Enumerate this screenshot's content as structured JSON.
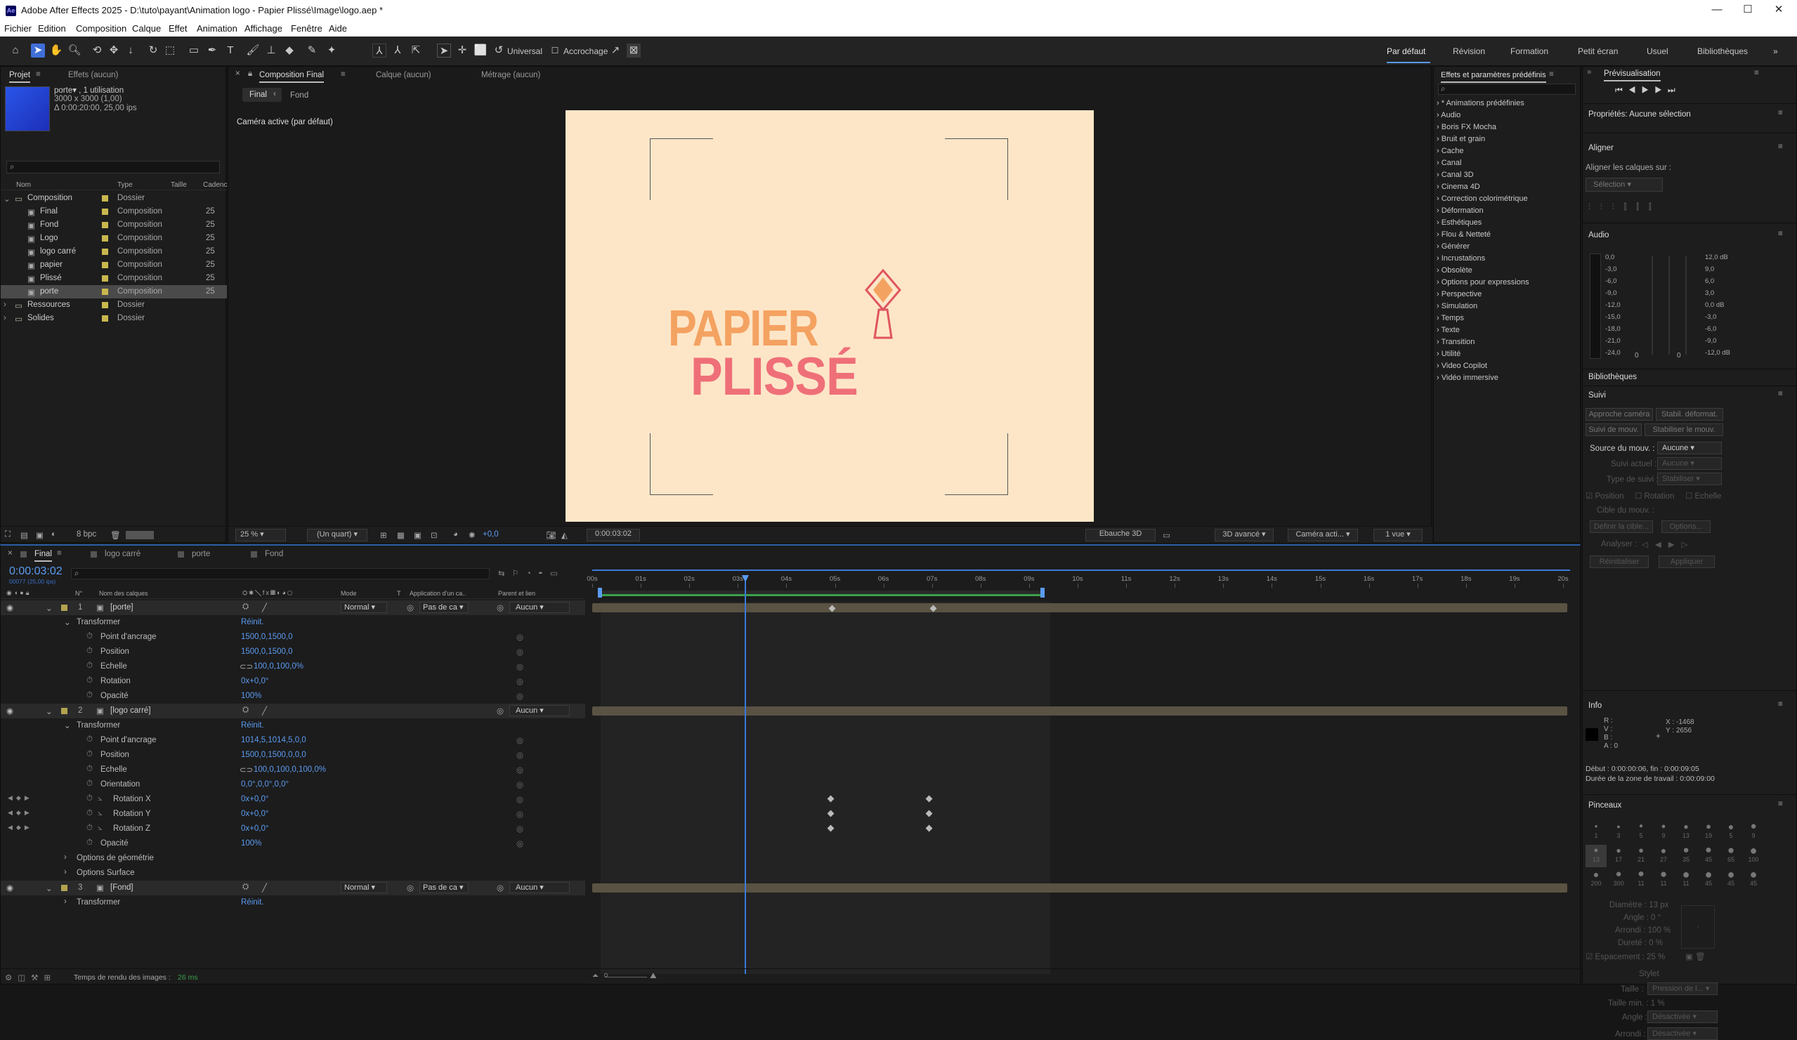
{
  "app": {
    "title": "Adobe After Effects 2025 - D:\\tuto\\payant\\Animation logo - Papier Plissé\\Image\\logo.aep *",
    "logo": "Ae"
  },
  "menu": [
    "Fichier",
    "Edition",
    "Composition",
    "Calque",
    "Effet",
    "Animation",
    "Affichage",
    "Fenêtre",
    "Aide"
  ],
  "toolbar": {
    "universal": "Universal",
    "snapping": "Accrochage"
  },
  "workspaces": [
    "Par défaut",
    "Révision",
    "Formation",
    "Petit écran",
    "Usuel",
    "Bibliothèques"
  ],
  "project": {
    "tabs": [
      "Projet",
      "Effets (aucun)"
    ],
    "selected_name": "porte▾ , 1 utilisation",
    "selected_size": "3000 x 3000 (1,00)",
    "selected_duration": "Δ 0:00:20:00, 25,00 ips",
    "columns": [
      "Nom",
      "Type",
      "Taille",
      "Cadenc"
    ],
    "items": [
      {
        "name": "Composition",
        "type": "Dossier",
        "fps": "",
        "indent": 0,
        "folder": true,
        "open": true
      },
      {
        "name": "Final",
        "type": "Composition",
        "fps": "25",
        "indent": 1
      },
      {
        "name": "Fond",
        "type": "Composition",
        "fps": "25",
        "indent": 1
      },
      {
        "name": "Logo",
        "type": "Composition",
        "fps": "25",
        "indent": 1
      },
      {
        "name": "logo carré",
        "type": "Composition",
        "fps": "25",
        "indent": 1
      },
      {
        "name": "papier",
        "type": "Composition",
        "fps": "25",
        "indent": 1
      },
      {
        "name": "Plissé",
        "type": "Composition",
        "fps": "25",
        "indent": 1
      },
      {
        "name": "porte",
        "type": "Composition",
        "fps": "25",
        "indent": 1,
        "selected": true
      },
      {
        "name": "Ressources",
        "type": "Dossier",
        "fps": "",
        "indent": 0,
        "folder": true
      },
      {
        "name": "Solides",
        "type": "Dossier",
        "fps": "",
        "indent": 0,
        "folder": true
      }
    ],
    "bpc": "8 bpc"
  },
  "viewer": {
    "tabs": [
      "Composition Final",
      "Calque (aucun)",
      "Métrage (aucun)"
    ],
    "subtabs": [
      "Final",
      "Fond"
    ],
    "camera_label": "Caméra active (par défaut)",
    "logo_line1": "PAPIER",
    "logo_line2": "PLISSÉ",
    "zoom": "25 %",
    "quality": "(Un quart)",
    "exposure": "+0,0",
    "timecode": "0:00:03:02",
    "draft": "Ebauche 3D",
    "renderer": "3D avancé",
    "camera": "Caméra acti...",
    "views": "1 vue",
    "colors": {
      "bg": "#fde6c8",
      "orange": "#f4a261",
      "pink": "#ef6f78",
      "red": "#e05560"
    }
  },
  "effects": {
    "title": "Effets et paramètres prédéfinis",
    "items": [
      "* Animations prédéfinies",
      "Audio",
      "Boris FX Mocha",
      "Bruit et grain",
      "Cache",
      "Canal",
      "Canal 3D",
      "Cinema 4D",
      "Correction colorimétrique",
      "Déformation",
      "Esthétiques",
      "Flou & Netteté",
      "Générer",
      "Incrustations",
      "Obsolète",
      "Options pour expressions",
      "Perspective",
      "Simulation",
      "Temps",
      "Texte",
      "Transition",
      "Utilité",
      "Video Copilot",
      "Vidéo immersive"
    ]
  },
  "right": {
    "preview": "Prévisualisation",
    "properties": "Propriétés: Aucune sélection",
    "align": "Aligner",
    "align_to": "Aligner les calques sur :",
    "align_sel": "Sélection",
    "audio": "Audio",
    "audio_left": [
      "0,0",
      "-3,0",
      "-6,0",
      "-9,0",
      "-12,0",
      "-15,0",
      "-18,0",
      "-21,0",
      "-24,0"
    ],
    "audio_right": [
      "12,0 dB",
      "9,0",
      "6,0",
      "3,0",
      "0,0 dB",
      "-3,0",
      "-6,0",
      "-9,0",
      "-12,0 dB"
    ],
    "audio_zero": [
      "0",
      "0"
    ],
    "libraries": "Bibliothèques",
    "tracking": "Suivi",
    "track_btns": [
      "Approche caméra",
      "Stabil. déformat.",
      "Suivi de mouv.",
      "Stabiliser le mouv."
    ],
    "source_label": "Source du mouv. :",
    "source_val": "Aucune",
    "current_label": "Suivi actuel :",
    "current_val": "Aucune",
    "type_label": "Type de suivi :",
    "type_val": "Stabiliser",
    "checks": [
      "Position",
      "Rotation",
      "Echelle"
    ],
    "target": "Cible du mouv. :",
    "target_btns": [
      "Définir la cible...",
      "Options..."
    ],
    "analyse": "Analyser :",
    "reset_btns": [
      "Réinitialiser",
      "Appliquer"
    ],
    "info": "Info",
    "info_rvba": [
      "R :",
      "V :",
      "B :",
      "A : 0"
    ],
    "info_x": "X : -1468",
    "info_y": "Y : 2656",
    "info_start": "Début : 0:00:00:06, fin : 0:00:09:05",
    "info_work": "Durée de la zone de travail : 0:00:09:00",
    "brushes": "Pinceaux",
    "brush_sizes": [
      "1",
      "3",
      "5",
      "9",
      "13",
      "19",
      "5",
      "9",
      "13",
      "17",
      "21",
      "27",
      "35",
      "45",
      "65",
      "100",
      "200",
      "300",
      "11",
      "11",
      "11",
      "45",
      "45",
      "45"
    ],
    "brush_diam": "Diamètre : 13 px",
    "brush_angle": "Angle : 0 °",
    "brush_round": "Arrondi : 100 %",
    "brush_hard": "Dureté : 0 %",
    "brush_space": "Espacement : 25 %",
    "stylet": "Stylet",
    "stylet_size": "Taille :",
    "stylet_size_val": "Pression de l...",
    "stylet_min": "Taille min. : 1 %",
    "stylet_angle": "Angle :",
    "stylet_angle_val": "Désactivée",
    "stylet_round": "Arrondi :",
    "stylet_round_val": "Désactivée"
  },
  "timeline": {
    "tabs": [
      "Final",
      "logo carré",
      "porte",
      "Fond"
    ],
    "timecode": "0:00:03:02",
    "frames": "00077 (25,00 ips)",
    "cols": [
      "N°",
      "Nom des calques",
      "Mode",
      "T",
      "Application d'un ca..",
      "Parent et lien"
    ],
    "ruler": [
      "00s",
      "01s",
      "02s",
      "03s",
      "04s",
      "05s",
      "06s",
      "07s",
      "08s",
      "09s",
      "10s",
      "11s",
      "12s",
      "13s",
      "14s",
      "15s",
      "16s",
      "17s",
      "18s",
      "19s",
      "20s"
    ],
    "rows": [
      {
        "kind": "layer",
        "num": "1",
        "name": "[porte]",
        "mode": "Normal",
        "matte": "Pas de ca",
        "parent": "Aucun",
        "label": "#b3a34f"
      },
      {
        "kind": "group",
        "name": "Transformer",
        "value": "Réinit."
      },
      {
        "kind": "prop",
        "name": "Point d'ancrage",
        "value": "1500,0,1500,0"
      },
      {
        "kind": "prop",
        "name": "Position",
        "value": "1500,0,1500,0"
      },
      {
        "kind": "prop",
        "name": "Echelle",
        "value": "100,0,100,0%",
        "link": true
      },
      {
        "kind": "prop",
        "name": "Rotation",
        "value": "0x+0,0°"
      },
      {
        "kind": "prop",
        "name": "Opacité",
        "value": "100%"
      },
      {
        "kind": "layer",
        "num": "2",
        "name": "[logo carré]",
        "mode": "",
        "matte": "",
        "parent": "Aucun",
        "label": "#b3a34f"
      },
      {
        "kind": "group",
        "name": "Transformer",
        "value": "Réinit."
      },
      {
        "kind": "prop",
        "name": "Point d'ancrage",
        "value": "1014,5,1014,5,0,0"
      },
      {
        "kind": "prop",
        "name": "Position",
        "value": "1500,0,1500,0,0,0"
      },
      {
        "kind": "prop",
        "name": "Echelle",
        "value": "100,0,100,0,100,0%",
        "link": true
      },
      {
        "kind": "prop",
        "name": "Orientation",
        "value": "0,0°,0,0°,0,0°"
      },
      {
        "kind": "prop",
        "name": "Rotation X",
        "value": "0x+0,0°",
        "key": true
      },
      {
        "kind": "prop",
        "name": "Rotation Y",
        "value": "0x+0,0°",
        "key": true
      },
      {
        "kind": "prop",
        "name": "Rotation Z",
        "value": "0x+0,0°",
        "key": true
      },
      {
        "kind": "prop",
        "name": "Opacité",
        "value": "100%"
      },
      {
        "kind": "group2",
        "name": "Options de géométrie",
        "value": ""
      },
      {
        "kind": "group2",
        "name": "Options Surface",
        "value": ""
      },
      {
        "kind": "layer",
        "num": "3",
        "name": "[Fond]",
        "mode": "Normal",
        "matte": "Pas de ca",
        "parent": "Aucun",
        "label": "#b3a34f"
      },
      {
        "kind": "group2",
        "name": "Transformer",
        "value": "Réinit."
      }
    ],
    "render_label": "Temps de rendu des images :",
    "render_val": "26 ms"
  }
}
